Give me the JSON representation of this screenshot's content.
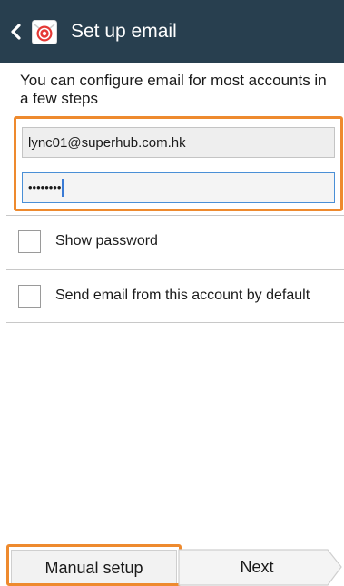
{
  "actionbar": {
    "title": "Set up email",
    "back_icon": "chevron-left-icon",
    "app_icon": "email-app-icon",
    "background": "#283f4f"
  },
  "intro": {
    "text": "You can configure email for most accounts in a few steps"
  },
  "form": {
    "email_value": "lync01@superhub.com.hk",
    "password_masked": "••••••••"
  },
  "options": [
    {
      "label": "Show password",
      "checked": false
    },
    {
      "label": "Send email from this account by default",
      "checked": false
    }
  ],
  "buttons": {
    "manual_setup": "Manual setup",
    "next": "Next"
  },
  "colors": {
    "highlight": "#ee8a2e",
    "focus": "#4a8fd6"
  }
}
